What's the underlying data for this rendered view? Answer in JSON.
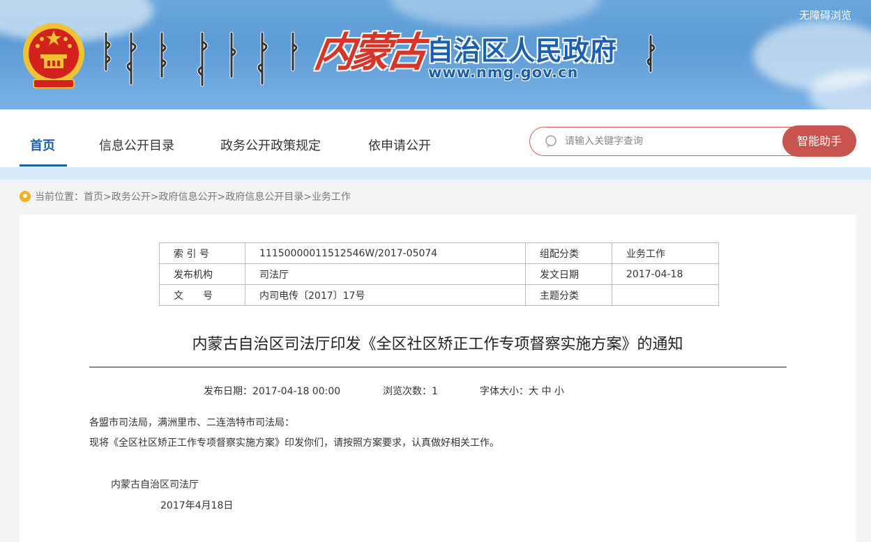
{
  "header": {
    "calligraphy": "内蒙古",
    "gov_name": "自治区人民政府",
    "url": "www.nmg.gov.cn",
    "accessibility": "无障碍浏览"
  },
  "nav": {
    "items": [
      {
        "label": "首页",
        "active": true
      },
      {
        "label": "信息公开目录"
      },
      {
        "label": "政务公开政策规定"
      },
      {
        "label": "依申请公开"
      }
    ],
    "search_placeholder": "请输入关键字查询",
    "assistant_label": "智能助手"
  },
  "breadcrumb": {
    "prefix": "当前位置：",
    "items": [
      "首页",
      "政务公开",
      "政府信息公开",
      "政府信息公开目录",
      "业务工作"
    ],
    "separator": ">"
  },
  "meta": {
    "rows": [
      {
        "k1": "索 引 号",
        "v1": "11150000011512546W/2017-05074",
        "k2": "组配分类",
        "v2": "业务工作"
      },
      {
        "k1": "发布机构",
        "v1": "司法厅",
        "k2": "发文日期",
        "v2": "2017-04-18"
      },
      {
        "k1": "文　　号",
        "v1": "内司电传〔2017〕17号",
        "k2": "主题分类",
        "v2": ""
      }
    ]
  },
  "article": {
    "title": "内蒙古自治区司法厅印发《全区社区矫正工作专项督察实施方案》的通知",
    "publish_date": "发布日期：2017-04-18 00:00",
    "views": "浏览次数：1",
    "font_size_label": "字体大小：",
    "font_large": "大",
    "font_medium": "中",
    "font_small": "小",
    "salutation": "各盟市司法局，满洲里市、二连浩特市司法局：",
    "body": "现将《全区社区矫正工作专项督察实施方案》印发你们，请按照方案要求，认真做好相关工作。",
    "signature": "内蒙古自治区司法厅",
    "date": "2017年4月18日"
  },
  "colors": {
    "brand_blue": "#1c5ea8",
    "accent_red": "#c9534f"
  }
}
